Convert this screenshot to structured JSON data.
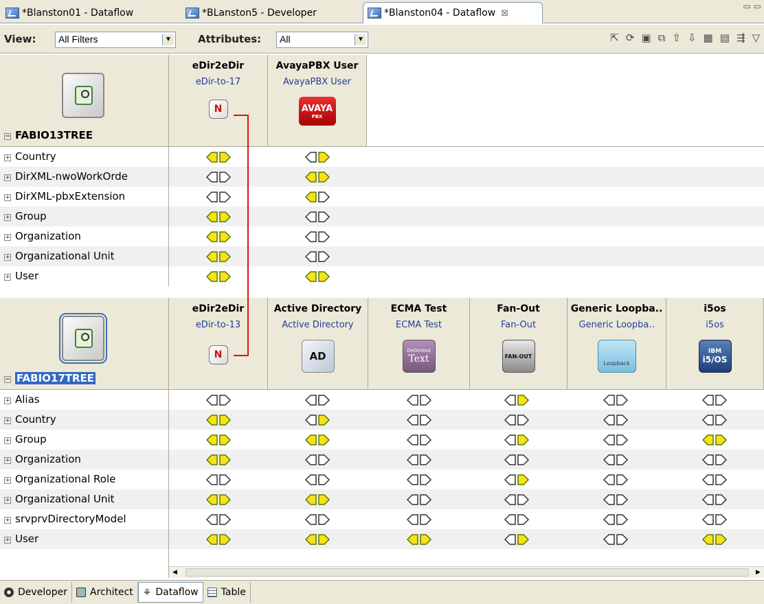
{
  "tabs": [
    {
      "label": "*Blanston01 - Dataflow"
    },
    {
      "label": "*BLanston5 - Developer"
    },
    {
      "label": "*Blanston04 - Dataflow",
      "close": "⊠"
    }
  ],
  "toolbar": {
    "view_label": "View:",
    "view_value": "All Filters",
    "attributes_label": "Attributes:",
    "attributes_value": "All",
    "icons": [
      "export-icon",
      "refresh-icon",
      "save-icon",
      "copy-icon",
      "up-arrow-icon",
      "down-arrow-icon",
      "properties-icon",
      "page-icon",
      "filter-icon",
      "menu-icon"
    ]
  },
  "tree1": {
    "name": "FABIO13TREE",
    "drivers": [
      {
        "name": "eDir2eDir",
        "sub": "eDir-to-17",
        "icon": "edir-icon"
      },
      {
        "name": "AvayaPBX User",
        "sub": "AvayaPBX User",
        "icon": "avaya-icon"
      }
    ],
    "rows": [
      {
        "label": "Country",
        "cells": [
          "both",
          "right"
        ]
      },
      {
        "label": "DirXML-nwoWorkOrde",
        "cells": [
          "none",
          "both"
        ]
      },
      {
        "label": "DirXML-pbxExtension",
        "cells": [
          "none",
          "left"
        ]
      },
      {
        "label": "Group",
        "cells": [
          "both",
          "none"
        ]
      },
      {
        "label": "Organization",
        "cells": [
          "both",
          "none"
        ]
      },
      {
        "label": "Organizational Unit",
        "cells": [
          "both",
          "none"
        ]
      },
      {
        "label": "User",
        "cells": [
          "both",
          "both"
        ]
      }
    ]
  },
  "tree2": {
    "name": "FABIO17TREE",
    "drivers": [
      {
        "name": "eDir2eDir",
        "sub": "eDir-to-13",
        "icon": "edir-icon"
      },
      {
        "name": "Active Directory",
        "sub": "Active Directory",
        "icon": "ad-icon"
      },
      {
        "name": "ECMA Test",
        "sub": "ECMA Test",
        "icon": "delimited-text-icon"
      },
      {
        "name": "Fan-Out",
        "sub": "Fan-Out",
        "icon": "fan-out-icon"
      },
      {
        "name": "Generic Loopba..",
        "sub": "Generic Loopba..",
        "icon": "loopback-icon"
      },
      {
        "name": "i5os",
        "sub": "i5os",
        "icon": "i5os-icon"
      }
    ],
    "rows": [
      {
        "label": "Alias",
        "cells": [
          "none",
          "none",
          "none",
          "right",
          "none",
          "none"
        ]
      },
      {
        "label": "Country",
        "cells": [
          "both",
          "right",
          "none",
          "none",
          "none",
          "none"
        ]
      },
      {
        "label": "Group",
        "cells": [
          "both",
          "both",
          "none",
          "right",
          "none",
          "both"
        ]
      },
      {
        "label": "Organization",
        "cells": [
          "both",
          "none",
          "none",
          "none",
          "none",
          "none"
        ]
      },
      {
        "label": "Organizational Role",
        "cells": [
          "none",
          "none",
          "none",
          "right",
          "none",
          "none"
        ]
      },
      {
        "label": "Organizational Unit",
        "cells": [
          "both",
          "both",
          "none",
          "none",
          "none",
          "none"
        ]
      },
      {
        "label": "srvprvDirectoryModel",
        "cells": [
          "none",
          "none",
          "none",
          "none",
          "none",
          "none"
        ]
      },
      {
        "label": "User",
        "cells": [
          "both",
          "both",
          "both",
          "right",
          "none",
          "both"
        ]
      }
    ]
  },
  "icon_text": {
    "avaya": "AVAYA",
    "avaya_sub": "PBX",
    "ad": "AD",
    "delimited": "Delimited",
    "text": "Text",
    "fanout": "FAN-OUT",
    "loopback": "Loopback",
    "ibm": "IBM",
    "i5os": "i5/OS"
  },
  "bottom_tabs": [
    {
      "label": "Developer",
      "icon": "developer-icon"
    },
    {
      "label": "Architect",
      "icon": "architect-icon"
    },
    {
      "label": "Dataflow",
      "icon": "dataflow-icon",
      "active": true
    },
    {
      "label": "Table",
      "icon": "table-icon"
    }
  ],
  "colors": {
    "accent": "#316ac5",
    "arrow_fill": "#f7e21a",
    "arrow_stroke": "#5a7a00",
    "link_line": "#e01010"
  }
}
